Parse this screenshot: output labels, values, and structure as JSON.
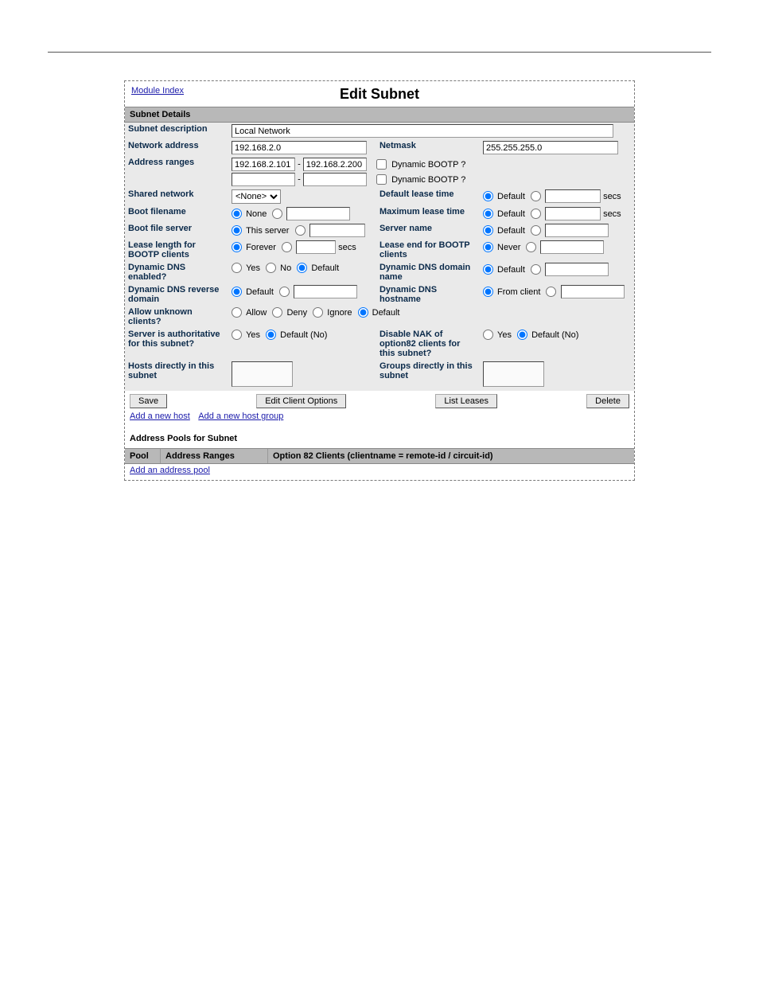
{
  "header": {
    "module_index": "Module Index",
    "title": "Edit Subnet"
  },
  "section": "Subnet Details",
  "labels": {
    "subnet_description": "Subnet description",
    "network_address": "Network address",
    "netmask": "Netmask",
    "address_ranges": "Address ranges",
    "dynamic_bootp": "Dynamic BOOTP ?",
    "shared_network": "Shared network",
    "default_lease_time": "Default lease time",
    "boot_filename": "Boot filename",
    "maximum_lease_time": "Maximum lease time",
    "boot_file_server": "Boot file server",
    "server_name": "Server name",
    "lease_length_bootp": "Lease length for BOOTP clients",
    "lease_end_bootp": "Lease end for BOOTP clients",
    "dynamic_dns_enabled": "Dynamic DNS enabled?",
    "dynamic_dns_domain": "Dynamic DNS domain name",
    "dynamic_dns_reverse": "Dynamic DNS reverse domain",
    "dynamic_dns_hostname": "Dynamic DNS hostname",
    "allow_unknown": "Allow unknown clients?",
    "server_authoritative": "Server is authoritative for this subnet?",
    "disable_nak": "Disable NAK of option82 clients for this subnet?",
    "hosts_directly": "Hosts directly in this subnet",
    "groups_directly": "Groups directly in this subnet"
  },
  "values": {
    "subnet_description": "Local Network",
    "network_address": "192.168.2.0",
    "netmask": "255.255.255.0",
    "range_from_1": "192.168.2.101",
    "range_to_1": "192.168.2.200",
    "range_from_2": "",
    "range_to_2": "",
    "shared_network": "<None>",
    "default_lease_value": "",
    "maximum_lease_value": "",
    "boot_filename": "",
    "boot_server": "",
    "server_name": "",
    "lease_length_bootp": "",
    "lease_end_bootp": "",
    "ddns_domain": "",
    "ddns_reverse": "",
    "ddns_hostname": ""
  },
  "radios": {
    "none": "None",
    "default": "Default",
    "this_server": "This server",
    "forever": "Forever",
    "never": "Never",
    "yes": "Yes",
    "no": "No",
    "from_client": "From client",
    "allow": "Allow",
    "deny": "Deny",
    "ignore": "Ignore",
    "default_no": "Default (No)"
  },
  "units": {
    "secs": "secs",
    "dash": "-"
  },
  "buttons": {
    "save": "Save",
    "edit_client_options": "Edit Client Options",
    "list_leases": "List Leases",
    "delete": "Delete"
  },
  "links": {
    "add_host": "Add a new host",
    "add_host_group": "Add a new host group",
    "add_pool": "Add an address pool"
  },
  "pools": {
    "title": "Address Pools for Subnet",
    "col_pool": "Pool",
    "col_ranges": "Address Ranges",
    "col_opt82": "Option 82 Clients (clientname = remote-id / circuit-id)"
  }
}
